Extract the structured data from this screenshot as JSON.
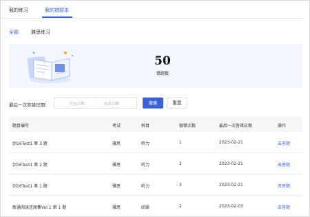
{
  "tabs": [
    {
      "label": "我的练习"
    },
    {
      "label": "我的错题本"
    }
  ],
  "filters": [
    {
      "label": "全部"
    },
    {
      "label": "雅思练习"
    }
  ],
  "summary": {
    "count": "50",
    "count_label": "错题数"
  },
  "search": {
    "label": "最后一次答错日期：",
    "start_placeholder": "开始日期",
    "separator": "-",
    "end_placeholder": "结束日期",
    "search_button": "搜索",
    "reset_button": "重置"
  },
  "table": {
    "headers": [
      "题目编号",
      "考试",
      "科目",
      "做错次数",
      "最后一次答错日期",
      "操作"
    ],
    "rows": [
      {
        "id": "剑16Test1 第 3 题",
        "exam": "雅思",
        "subject": "听力",
        "times": "1",
        "date": "2023-02-21",
        "action": "去答题"
      },
      {
        "id": "剑16Test1 第 2 题",
        "exam": "雅思",
        "subject": "听力",
        "times": "2",
        "date": "2023-02-21",
        "action": "去答题"
      },
      {
        "id": "剑16Test1 第 1 题",
        "exam": "雅思",
        "subject": "听力",
        "times": "3",
        "date": "2023-02-21",
        "action": "去答题"
      },
      {
        "id": "新通阅读还原集Vol.1 第 1 题",
        "exam": "雅思",
        "subject": "阅读",
        "times": "2",
        "date": "2023-02-03",
        "action": "去答题"
      }
    ]
  },
  "colors": {
    "accent": "#3a62d7",
    "banner_bg": "#f3f6fd",
    "header_bg": "#f5f6f8"
  },
  "icons": {
    "banner_illustration": "open-book-illustration"
  }
}
